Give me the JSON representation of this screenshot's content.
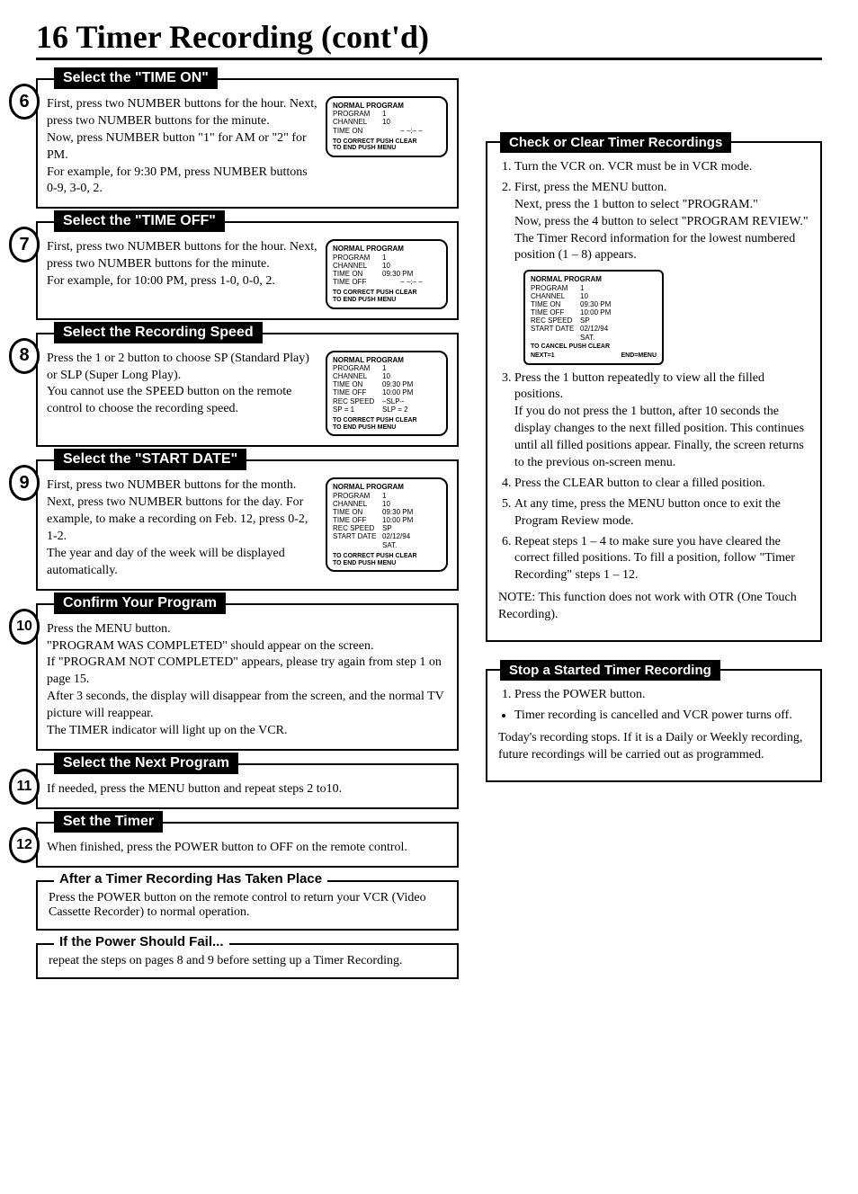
{
  "page": {
    "number": "16",
    "title": "Timer Recording (cont'd)"
  },
  "steps": [
    {
      "num": "6",
      "title": "Select the \"TIME ON\"",
      "text": "First, press two NUMBER buttons for the hour. Next, press two NUMBER buttons for the minute.\nNow, press NUMBER button \"1\" for AM or \"2\" for PM.\nFor example, for 9:30 PM, press NUMBER buttons 0-9, 3-0, 2.",
      "osd": {
        "title": "NORMAL PROGRAM",
        "rows": [
          [
            "PROGRAM",
            "1"
          ],
          [
            "CHANNEL",
            "10"
          ],
          [
            "TIME ON",
            "– –:– –"
          ]
        ],
        "foot": "TO CORRECT PUSH CLEAR\nTO END PUSH MENU"
      }
    },
    {
      "num": "7",
      "title": "Select the \"TIME OFF\"",
      "text": "First, press two NUMBER buttons for the hour. Next, press two NUMBER buttons for the minute.\nFor example, for 10:00 PM, press 1-0, 0-0, 2.",
      "osd": {
        "title": "NORMAL PROGRAM",
        "rows": [
          [
            "PROGRAM",
            "1"
          ],
          [
            "CHANNEL",
            "10"
          ],
          [
            "TIME ON",
            "09:30 PM"
          ],
          [
            "TIME OFF",
            "– –:– –"
          ]
        ],
        "foot": "TO CORRECT PUSH CLEAR\nTO END PUSH MENU"
      }
    },
    {
      "num": "8",
      "title": "Select the Recording Speed",
      "text": "Press the 1 or 2 button to choose SP (Standard Play) or SLP (Super Long Play).\nYou cannot use the SPEED button on the remote control to choose the recording speed.",
      "osd": {
        "title": "NORMAL PROGRAM",
        "rows": [
          [
            "PROGRAM",
            "1"
          ],
          [
            "CHANNEL",
            "10"
          ],
          [
            "TIME ON",
            "09:30 PM"
          ],
          [
            "TIME OFF",
            "10:00 PM"
          ],
          [
            "REC SPEED",
            "–SLP–"
          ],
          [
            "SP = 1",
            "SLP = 2"
          ]
        ],
        "foot": "TO CORRECT PUSH CLEAR\nTO END PUSH MENU"
      }
    },
    {
      "num": "9",
      "title": "Select the \"START DATE\"",
      "text": "First, press two NUMBER buttons for the month. Next, press two NUMBER buttons for the day. For example, to make a recording on Feb. 12, press 0-2, 1-2.\nThe year and day of the week will be displayed automatically.",
      "osd": {
        "title": "NORMAL PROGRAM",
        "rows": [
          [
            "PROGRAM",
            "1"
          ],
          [
            "CHANNEL",
            "10"
          ],
          [
            "TIME ON",
            "09:30 PM"
          ],
          [
            "TIME OFF",
            "10:00 PM"
          ],
          [
            "REC SPEED",
            "SP"
          ],
          [
            "START DATE",
            "02/12/94"
          ],
          [
            "",
            "SAT."
          ]
        ],
        "foot": "TO CORRECT PUSH CLEAR\nTO END PUSH MENU"
      }
    },
    {
      "num": "10",
      "title": "Confirm Your Program",
      "text": "Press the MENU button.\n\"PROGRAM WAS COMPLETED\" should appear on the screen.\nIf \"PROGRAM NOT COMPLETED\" appears, please try again from step 1 on page 15.\nAfter 3 seconds, the display will disappear from the screen, and the normal TV picture will reappear.\nThe TIMER indicator will light up on the VCR."
    },
    {
      "num": "11",
      "title": "Select the Next Program",
      "text": "If needed, press the MENU button and repeat steps 2 to10."
    },
    {
      "num": "12",
      "title": "Set the Timer",
      "text": "When finished, press the POWER button to OFF on the remote control."
    }
  ],
  "sub1": {
    "title": "After a Timer Recording Has Taken Place",
    "text": "Press the POWER button on the remote control to return your VCR (Video Cassette Recorder) to normal operation."
  },
  "sub2": {
    "title": "If the Power Should Fail...",
    "text": "repeat the steps on pages 8 and 9 before setting up a Timer Recording."
  },
  "check": {
    "title": "Check or Clear Timer Recordings",
    "li1": "Turn the VCR on. VCR must be in VCR mode.",
    "li2": "First, press the MENU button.\nNext, press the 1 button to select \"PROGRAM.\"\nNow, press the 4 button to select \"PROGRAM REVIEW.\"\nThe Timer Record information for the lowest numbered position (1 – 8) appears.",
    "osd": {
      "title": "NORMAL PROGRAM",
      "rows": [
        [
          "PROGRAM",
          "1"
        ],
        [
          "CHANNEL",
          "10"
        ],
        [
          "TIME ON",
          "09:30 PM"
        ],
        [
          "TIME OFF",
          "10:00 PM"
        ],
        [
          "REC SPEED",
          "SP"
        ],
        [
          "START DATE",
          "02/12/94"
        ],
        [
          "",
          "SAT."
        ]
      ],
      "foot1": "TO CANCEL PUSH CLEAR",
      "footL": "NEXT=1",
      "footR": "END=MENU"
    },
    "li3": "Press the 1 button repeatedly to view all the filled positions.\nIf you do not press the 1 button, after 10 seconds the display changes to the next filled position. This continues until all filled positions appear. Finally, the screen returns to the previous on-screen menu.",
    "li4": "Press the CLEAR button to clear a filled position.",
    "li5": "At any time, press the MENU button once to exit the Program Review mode.",
    "li6": "Repeat steps 1 – 4 to make sure you have cleared the correct filled positions. To fill a position, follow \"Timer Recording\" steps 1 – 12.",
    "note": "NOTE: This function does not work with OTR (One Touch Recording)."
  },
  "stop": {
    "title": "Stop a Started Timer Recording",
    "li1": "Press the POWER button.",
    "bullet": "Timer recording is cancelled and VCR power turns off.",
    "tail": "Today's recording stops. If it is a Daily or Weekly recording, future recordings will be carried out as programmed."
  }
}
